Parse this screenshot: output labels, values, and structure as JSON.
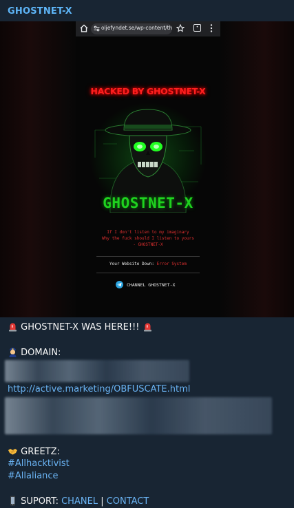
{
  "channel": {
    "name": "GHOSTNET-X"
  },
  "screenshot": {
    "browser": {
      "url": "oljefyndet.se/wp-content/the"
    },
    "page": {
      "headline": "HACKED BY GHOSTNET-X",
      "brand": "GHOSTNET-X",
      "quote_lines": [
        "If I don't listen to my imaginary",
        "Why the fuck should I listen to yours",
        "- GHOSTNET-X"
      ],
      "website_down_label": "Your Website Down:",
      "website_down_value": "Error System",
      "channel_label": "CHANNEL GHOSTNET-X"
    }
  },
  "message": {
    "headline": "GHOSTNET-X WAS HERE!!!",
    "domain_label": "DOMAIN:",
    "domain_link": "http://active.marketing/OBFUSCATE.html",
    "greetz_label": "GREETZ:",
    "hashtags": [
      "#Allhacktivist",
      "#Allaliance"
    ],
    "support_label": "SUPORT:",
    "support_links": [
      "CHANEL",
      "CONTACT"
    ],
    "support_separator": "|"
  },
  "icons": {
    "siren": "siren-emoji-icon",
    "cop": "police-officer-emoji-icon",
    "handshake": "handshake-emoji-icon",
    "phone": "mobile-phone-emoji-icon",
    "telegram": "telegram-icon"
  },
  "colors": {
    "accent": "#6ab3f3",
    "channel_name": "#5eb5f7",
    "hacked_red": "#ff1f1f",
    "brand_green": "#1fd21f",
    "background": "#182533"
  }
}
